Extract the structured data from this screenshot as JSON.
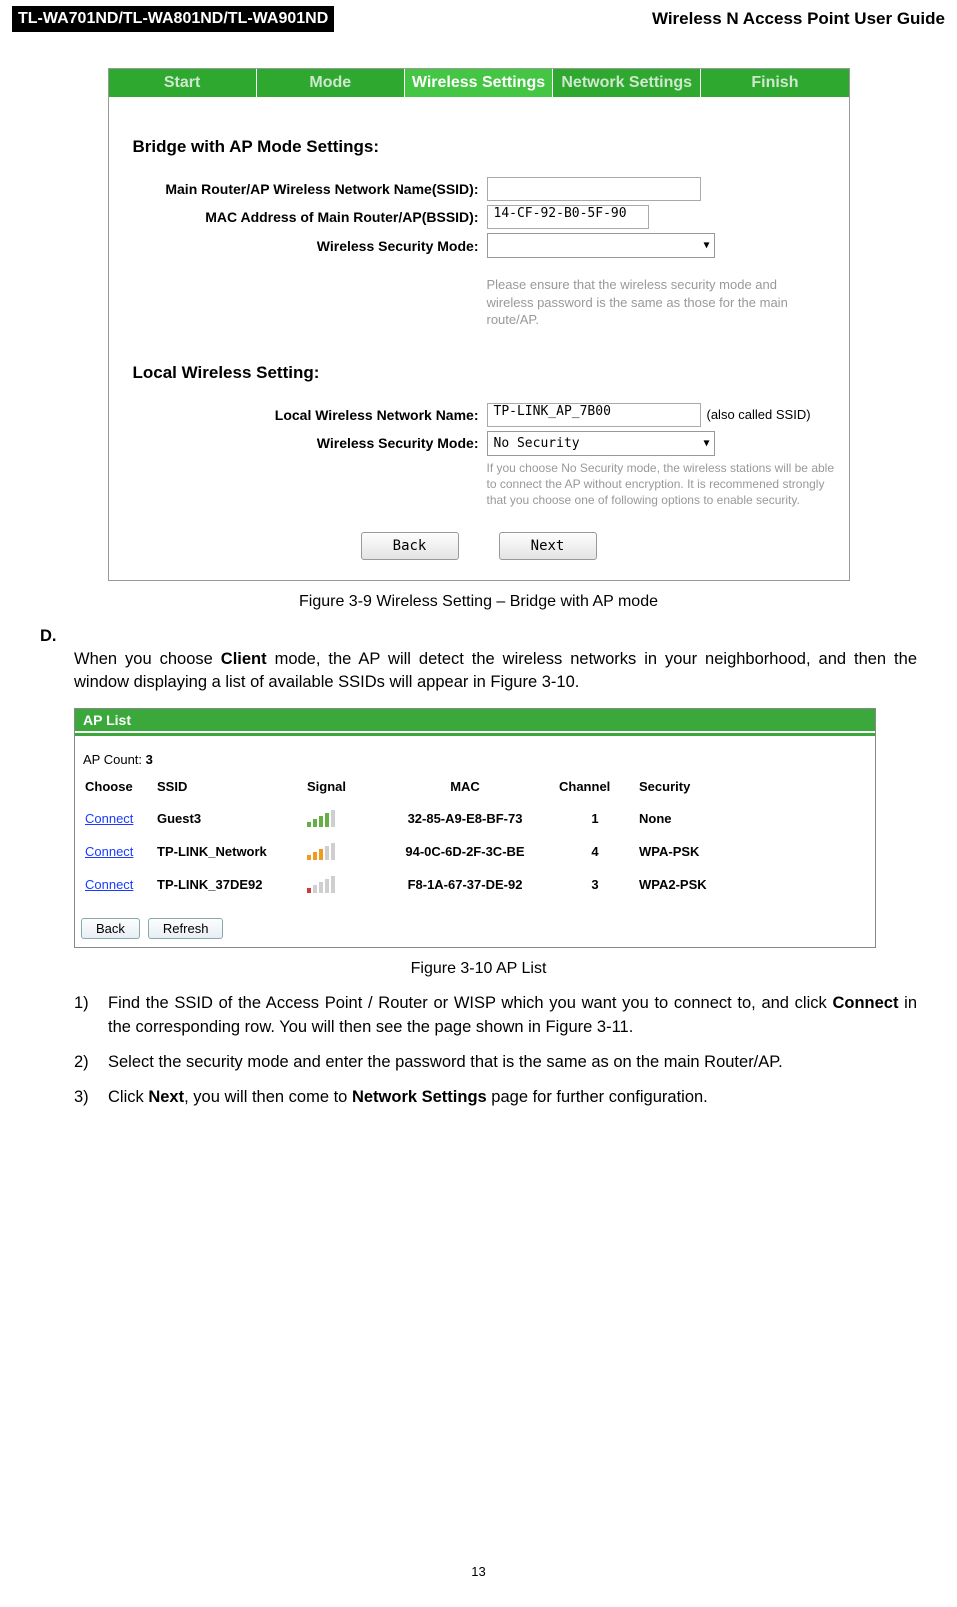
{
  "header": {
    "left": "TL-WA701ND/TL-WA801ND/TL-WA901ND",
    "right": "Wireless N Access Point User Guide"
  },
  "wizard": {
    "tabs": [
      "Start",
      "Mode",
      "Wireless Settings",
      "Network Settings",
      "Finish"
    ],
    "active": 2,
    "sec1_title": "Bridge with AP Mode Settings:",
    "ssid_label": "Main Router/AP Wireless Network Name(SSID):",
    "ssid_val": "",
    "bssid_label": "MAC Address of Main Router/AP(BSSID):",
    "bssid_val": "14-CF-92-B0-5F-90",
    "secmode_label": "Wireless Security Mode:",
    "secmode_val": "",
    "hint1": "Please ensure that the wireless security mode and wireless password is the same as those for the main route/AP.",
    "sec2_title": "Local Wireless Setting:",
    "local_name_label": "Local Wireless Network Name:",
    "local_name_val": "TP-LINK_AP_7B00",
    "also_ssid": "(also called SSID)",
    "local_sec_label": "Wireless Security Mode:",
    "local_sec_val": "No Security",
    "hint2": "If you choose No Security mode, the wireless stations will be able to connect the AP without encryption. It is recommened strongly that you choose one of following options to enable security.",
    "back": "Back",
    "next": "Next"
  },
  "fig1_cap": "Figure 3-9 Wireless Setting – Bridge with AP mode",
  "paraD_letter": "D.",
  "paraD_pre": "When  you  choose  ",
  "paraD_bold": "Client",
  "paraD_post": "  mode,  the  AP  will  detect  the  wireless  networks  in  your neighborhood, and then the window displaying a list of available SSIDs will appear in Figure 3-10.",
  "aplist": {
    "title": "AP List",
    "count_label": "AP Count:",
    "count": "3",
    "headers": [
      "Choose",
      "SSID",
      "Signal",
      "MAC",
      "Channel",
      "Security"
    ],
    "rows": [
      {
        "connect": "Connect",
        "ssid": "Guest3",
        "sig": "g4",
        "mac": "32-85-A9-E8-BF-73",
        "ch": "1",
        "sec": "None"
      },
      {
        "connect": "Connect",
        "ssid": "TP-LINK_Network",
        "sig": "o3",
        "mac": "94-0C-6D-2F-3C-BE",
        "ch": "4",
        "sec": "WPA-PSK"
      },
      {
        "connect": "Connect",
        "ssid": "TP-LINK_37DE92",
        "sig": "r1",
        "mac": "F8-1A-67-37-DE-92",
        "ch": "3",
        "sec": "WPA2-PSK"
      }
    ],
    "back": "Back",
    "refresh": "Refresh"
  },
  "fig2_cap": "Figure 3-10 AP List",
  "steps": [
    {
      "n": "1)",
      "pre": "Find the SSID of the Access Point / Router or WISP which you want you to connect to, and click ",
      "b": "Connect",
      "post": " in the corresponding row. You will then see the page shown in Figure 3-11."
    },
    {
      "n": "2)",
      "pre": "Select  the  security  mode  and  enter  the  password  that  is  the  same  as  on  the  main Router/AP.",
      "b": "",
      "post": ""
    },
    {
      "n": "3)",
      "pre": "Click ",
      "b": "Next",
      "mid": ", you will then come to ",
      "b2": "Network Settings",
      "post": " page for further configuration."
    }
  ],
  "pagenum": "13"
}
